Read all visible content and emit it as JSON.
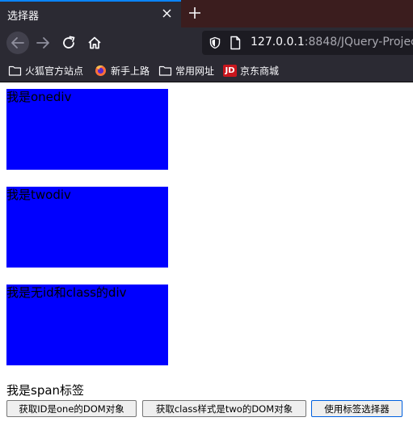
{
  "browser": {
    "tab_title": "选择器",
    "url_host": "127.0.0.1",
    "url_rest": ":8848/JQuery-Project/",
    "bookmarks": [
      {
        "label": "火狐官方站点",
        "icon": "folder-icon"
      },
      {
        "label": "新手上路",
        "icon": "firefox-icon"
      },
      {
        "label": "常用网址",
        "icon": "folder-icon"
      },
      {
        "label": "京东商城",
        "icon": "jd-icon",
        "badge": "JD"
      }
    ],
    "accent_color": "#0a84ff"
  },
  "page": {
    "divs": [
      {
        "text": "我是onediv"
      },
      {
        "text": "我是twodiv"
      },
      {
        "text": "我是无id和class的div"
      }
    ],
    "span_text": "我是span标签",
    "box_color": "#0000ff",
    "buttons": [
      {
        "label": "获取ID是one的DOM对象"
      },
      {
        "label": "获取class样式是two的DOM对象"
      },
      {
        "label": "使用标签选择器"
      }
    ]
  }
}
